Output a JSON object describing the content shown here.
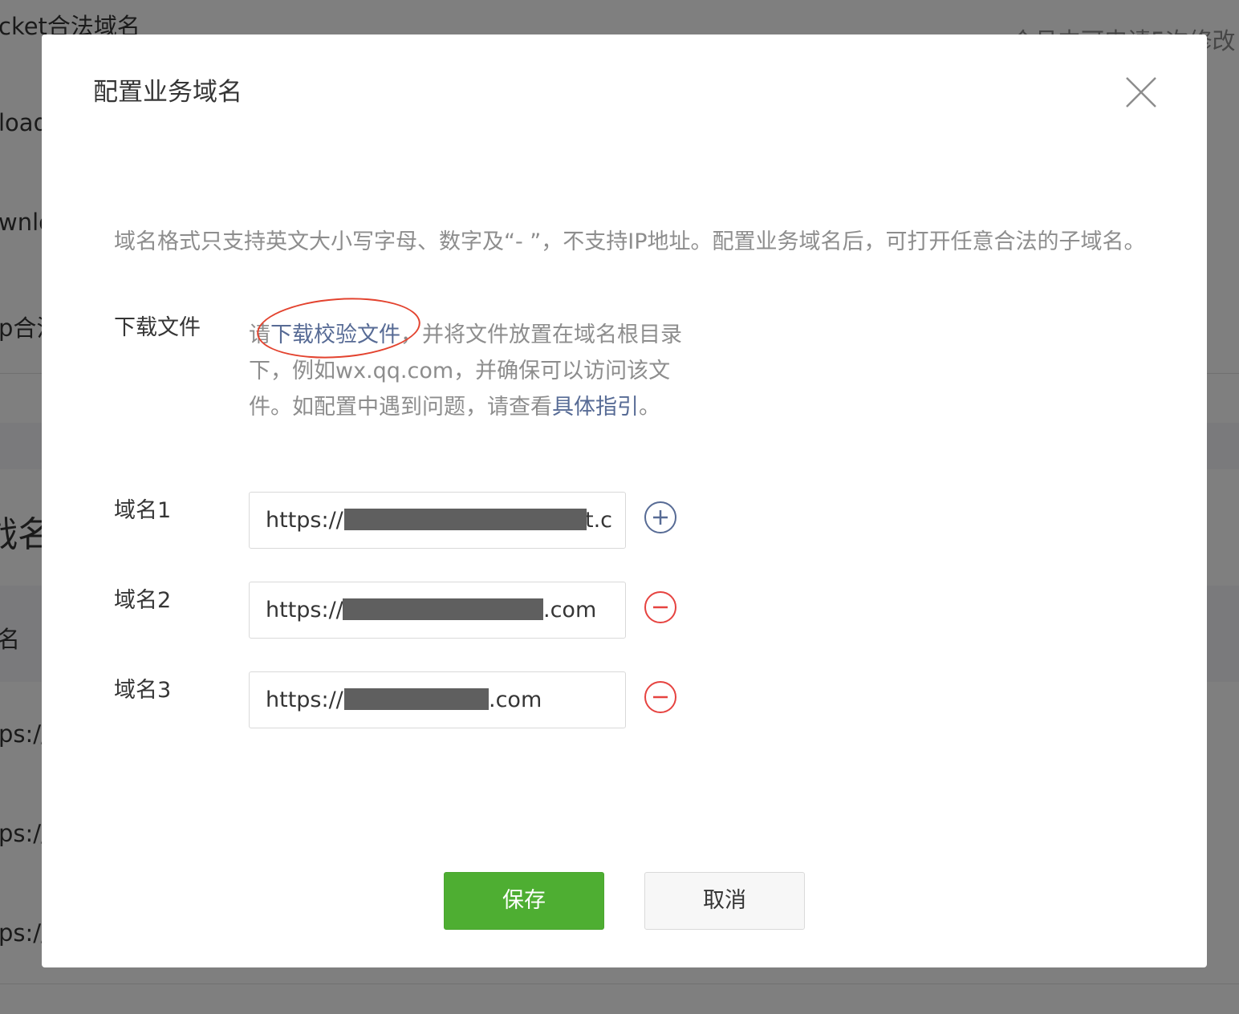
{
  "background": {
    "text_top_left": "cket合法域名",
    "text_top_right": "个月内可申请5次修改",
    "text_download_1": "load",
    "text_download_2": "wnlo",
    "text_app": "p合法",
    "text_heading": "战名",
    "text_col": "名",
    "text_row_1": "ps://",
    "text_row_2": "ps://",
    "text_row_3": "ps://"
  },
  "dialog": {
    "title": "配置业务域名",
    "description": "域名格式只支持英文大小写字母、数字及“- ”，不支持IP地址。配置业务域名后，可打开任意合法的子域名。",
    "download_label": "下载文件",
    "download_text_prefix": "请",
    "download_link": "下载校验文件",
    "download_text_middle": "，并将文件放置在域名根目录下，例如wx.qq.com，并确保可以访问该文件。如配置中遇到问题，请查看",
    "guide_link": "具体指引",
    "download_text_suffix": "。",
    "domains": [
      {
        "label": "域名1",
        "prefix": "https://",
        "visible_suffix": "t.c",
        "action": "add"
      },
      {
        "label": "域名2",
        "prefix": "https://",
        "visible_suffix": ".com",
        "action": "remove"
      },
      {
        "label": "域名3",
        "prefix": "https://",
        "visible_suffix": ".com",
        "action": "remove"
      }
    ],
    "save_label": "保存",
    "cancel_label": "取消"
  },
  "colors": {
    "primary_green": "#4eae32",
    "link_blue": "#576b95",
    "remove_red": "#e64340",
    "annotation_red": "#e3432f"
  },
  "icons": {
    "close": "close-icon",
    "add": "plus-circle-icon",
    "remove": "minus-circle-icon"
  }
}
